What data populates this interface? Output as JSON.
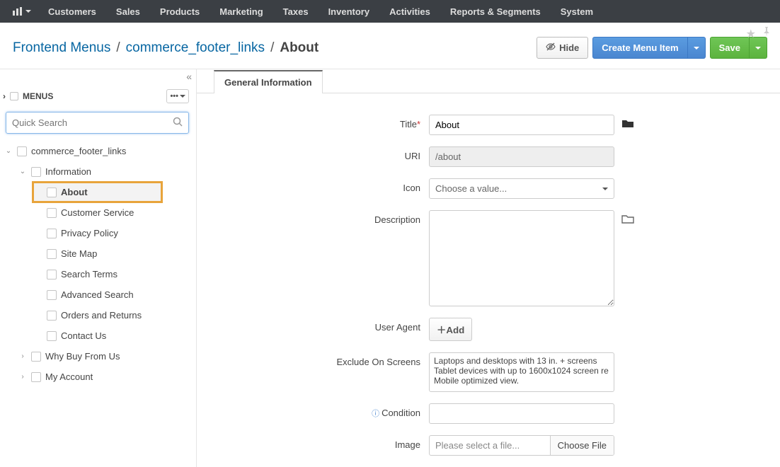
{
  "topnav": {
    "items": [
      "Customers",
      "Sales",
      "Products",
      "Marketing",
      "Taxes",
      "Inventory",
      "Activities",
      "Reports & Segments",
      "System"
    ]
  },
  "breadcrumb": {
    "a": "Frontend Menus",
    "b": "commerce_footer_links",
    "current": "About"
  },
  "actions": {
    "hide": "Hide",
    "create": "Create Menu Item",
    "save": "Save"
  },
  "sidebar": {
    "title": "MENUS",
    "search_placeholder": "Quick Search",
    "root": "commerce_footer_links",
    "group1": "Information",
    "items": [
      "About",
      "Customer Service",
      "Privacy Policy",
      "Site Map",
      "Search Terms",
      "Advanced Search",
      "Orders and Returns",
      "Contact Us"
    ],
    "group2": "Why Buy From Us",
    "group3": "My Account"
  },
  "tab": {
    "general": "General Information"
  },
  "form": {
    "title_label": "Title",
    "title_value": "About",
    "uri_label": "URI",
    "uri_value": "/about",
    "icon_label": "Icon",
    "icon_placeholder": "Choose a value...",
    "desc_label": "Description",
    "useragent_label": "User Agent",
    "add_btn": "Add",
    "exclude_label": "Exclude On Screens",
    "exclude_options": "Laptops and desktops with 13 in. + screens\nTablet devices with up to 1600x1024 screen re\nMobile optimized view.",
    "condition_label": "Condition",
    "image_label": "Image",
    "image_placeholder": "Please select a file...",
    "choose_file": "Choose File"
  }
}
